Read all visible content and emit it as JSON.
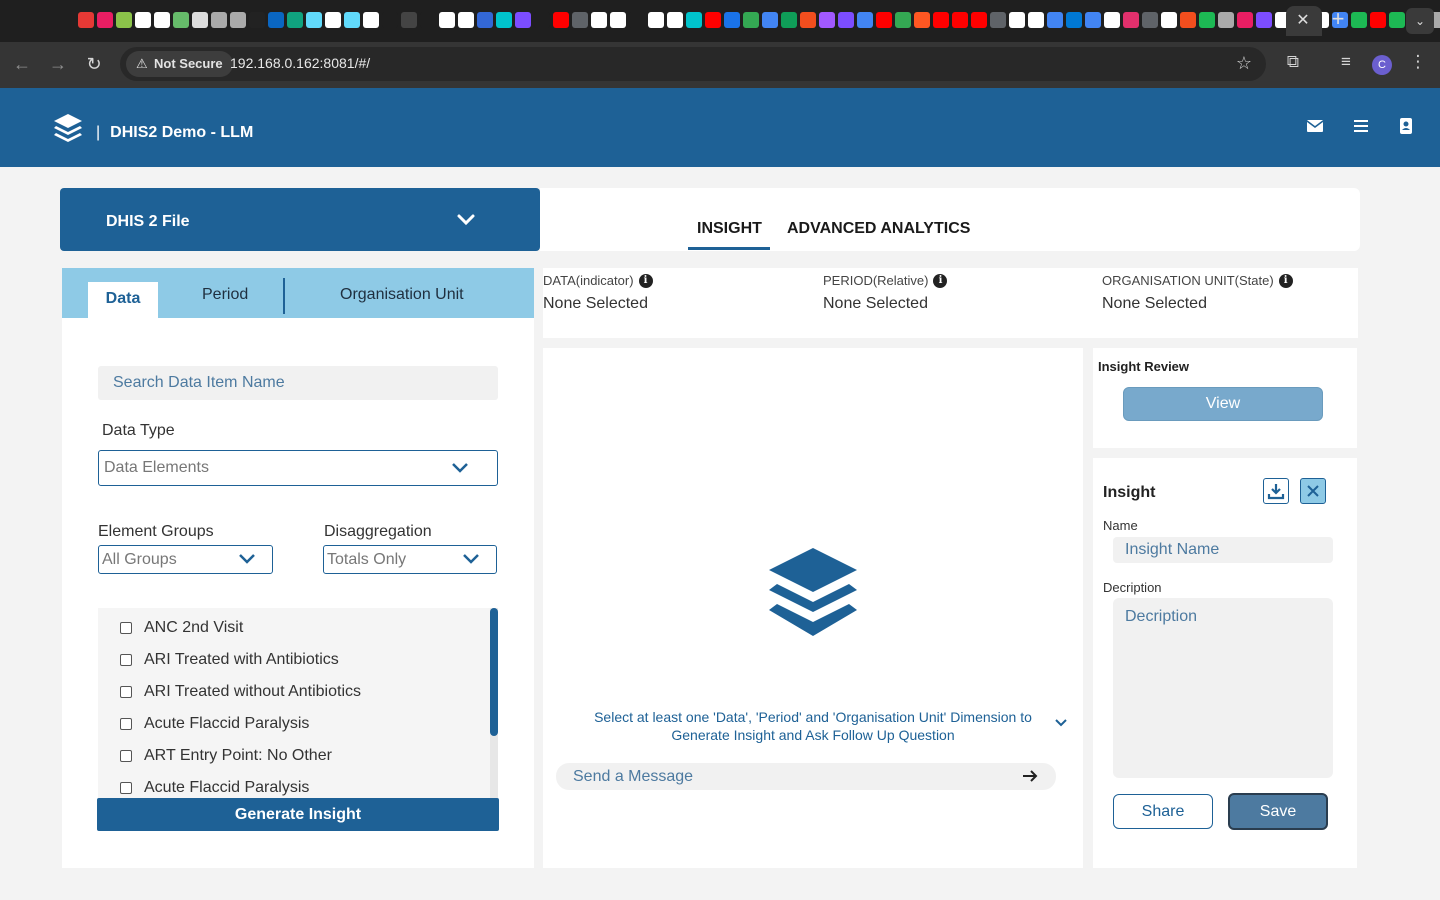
{
  "browser": {
    "security_label": "Not Secure",
    "url": "192.168.0.162:8081/#/",
    "avatar_letter": "C",
    "close_tab": "✕",
    "new_tab": "+",
    "tab_menu": "⌄"
  },
  "header": {
    "title": "DHIS2 Demo - LLM"
  },
  "file_selector": {
    "label": "DHIS 2 File"
  },
  "left_tabs": {
    "data": "Data",
    "period": "Period",
    "org_unit": "Organisation Unit"
  },
  "data_tab": {
    "search_placeholder": "Search Data Item Name",
    "data_type_label": "Data Type",
    "data_type_value": "Data Elements",
    "element_groups_label": "Element Groups",
    "element_groups_value": "All Groups",
    "disaggregation_label": "Disaggregation",
    "disaggregation_value": "Totals Only",
    "items": [
      "ANC 2nd Visit",
      "ARI Treated with Antibiotics",
      "ARI Treated without Antibiotics",
      "Acute Flaccid Paralysis",
      "ART Entry Point: No Other",
      "Acute Flaccid Paralysis"
    ],
    "generate_label": "Generate Insight"
  },
  "main_tabs": {
    "insight": "INSIGHT",
    "advanced": "ADVANCED ANALYTICS"
  },
  "dimensions": {
    "data_label": "DATA(indicator)",
    "data_value": "None Selected",
    "period_label": "PERIOD(Relative)",
    "period_value": "None Selected",
    "org_label": "ORGANISATION UNIT(State)",
    "org_value": "None Selected"
  },
  "chat": {
    "hint_line1": "Select at least one 'Data', 'Period' and 'Organisation Unit' Dimension to",
    "hint_line2": "Generate Insight and Ask Follow Up Question",
    "message_placeholder": "Send a Message"
  },
  "review": {
    "title": "Insight Review",
    "view_label": "View"
  },
  "insight_form": {
    "title": "Insight",
    "name_label": "Name",
    "name_placeholder": "Insight Name",
    "desc_label": "Decription",
    "desc_placeholder": "Decription",
    "share_label": "Share",
    "save_label": "Save"
  },
  "colors": {
    "brand": "#1e6196",
    "tab_bg": "#8ecae6",
    "save": "#4d7aa0",
    "view": "#78a9cc"
  }
}
